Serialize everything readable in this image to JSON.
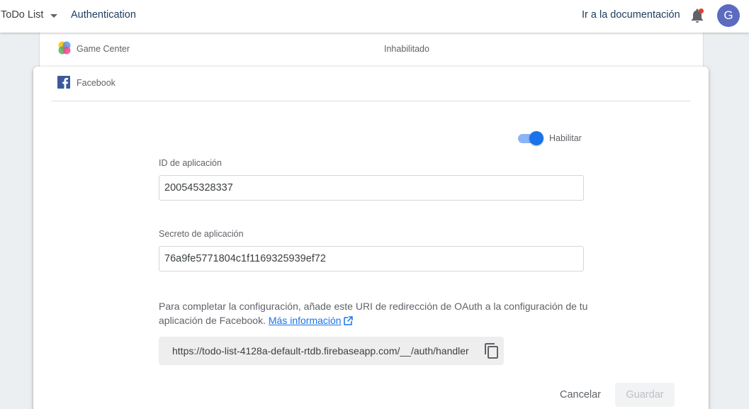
{
  "topbar": {
    "project_name": "ToDo List",
    "section_title": "Authentication",
    "docs_link": "Ir a la documentación",
    "avatar_initial": "G",
    "notification_dot_color": "#e53935"
  },
  "providers": {
    "game_center": {
      "name": "Game Center",
      "status": "Inhabilitado"
    },
    "facebook": {
      "name": "Facebook",
      "enable_label": "Habilitar",
      "enabled": true,
      "app_id_label": "ID de aplicación",
      "app_id_value": "200545328337",
      "app_secret_label": "Secreto de aplicación",
      "app_secret_value": "76a9fe5771804c1f1169325939ef72",
      "help_text": "Para completar la configuración, añade este URI de redirección de OAuth a la configuración de tu aplicación de Facebook.",
      "help_link": "Más información",
      "redirect_uri": "https://todo-list-4128a-default-rtdb.firebaseapp.com/__/auth/handler",
      "cancel_label": "Cancelar",
      "save_label": "Guardar"
    }
  },
  "colors": {
    "accent": "#1a73e8",
    "toggle_track": "#8ab4f8",
    "facebook_blue": "#3b5998",
    "avatar_bg": "#5c6bc0"
  }
}
